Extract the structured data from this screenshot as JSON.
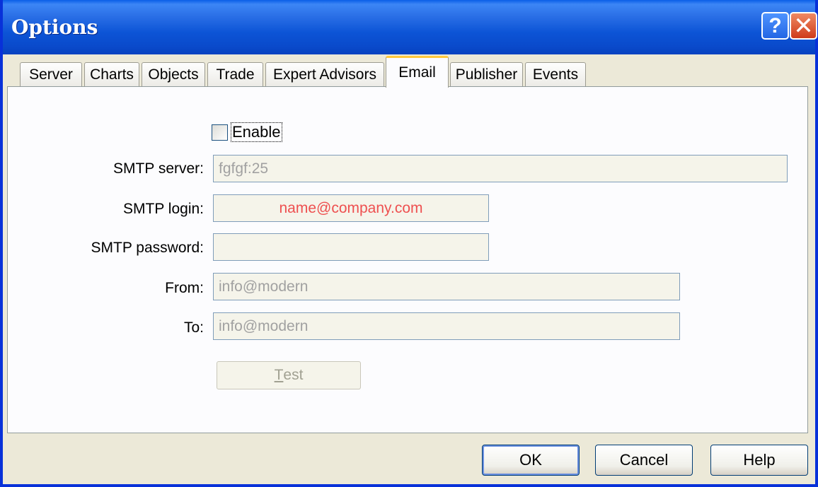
{
  "window": {
    "title": "Options",
    "help_glyph": "?",
    "close_glyph": "✕"
  },
  "tabs": [
    {
      "label": "Server",
      "active": false
    },
    {
      "label": "Charts",
      "active": false
    },
    {
      "label": "Objects",
      "active": false
    },
    {
      "label": "Trade",
      "active": false
    },
    {
      "label": "Expert Advisors",
      "active": false
    },
    {
      "label": "Email",
      "active": true
    },
    {
      "label": "Publisher",
      "active": false
    },
    {
      "label": "Events",
      "active": false
    }
  ],
  "form": {
    "enable_label": "Enable",
    "enable_checked": false,
    "smtp_server_label": "SMTP server:",
    "smtp_server_value": "fgfgf:25",
    "smtp_login_label": "SMTP login:",
    "smtp_login_value": "name@company.com",
    "smtp_password_label": "SMTP password:",
    "smtp_password_value": "",
    "from_label": "From:",
    "from_value": "info@modern",
    "to_label": "To:",
    "to_value": "info@modern",
    "test_label_underlined": "T",
    "test_label_rest": "est"
  },
  "buttons": {
    "ok": "OK",
    "cancel": "Cancel",
    "help": "Help"
  },
  "colors": {
    "titlebar": "#0a4acb",
    "accent_tab": "#ffc83c",
    "login_text": "#ee5050"
  }
}
